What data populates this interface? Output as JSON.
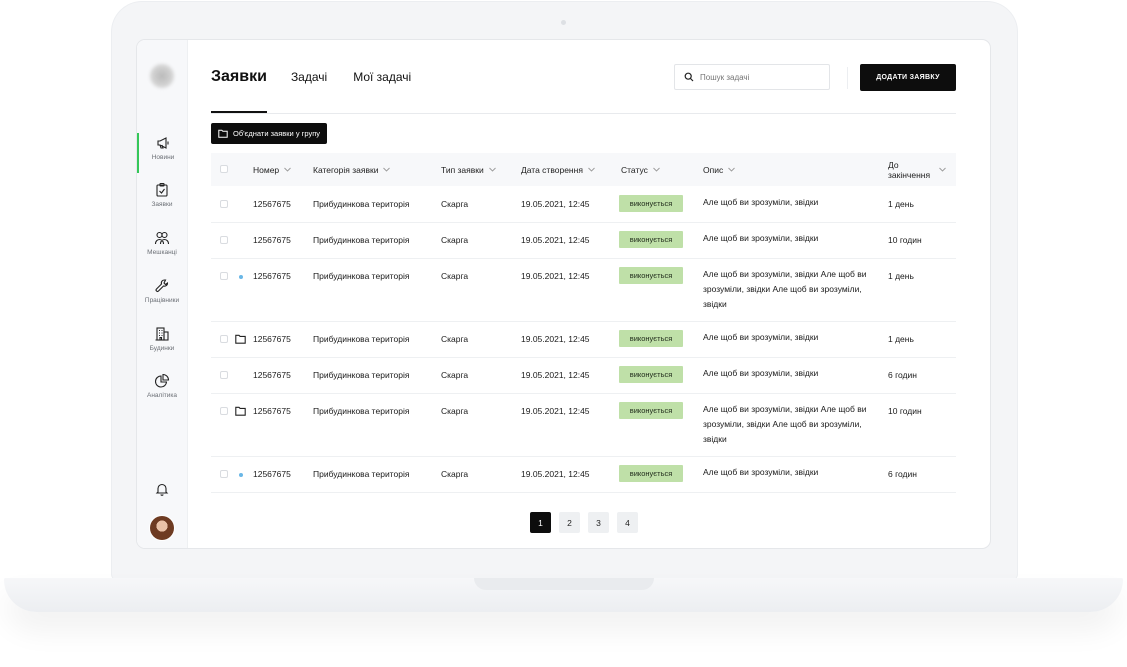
{
  "sidebar": {
    "items": [
      {
        "label": "Новини",
        "icon": "megaphone-icon",
        "active": true
      },
      {
        "label": "Заявки",
        "icon": "clipboard-check-icon",
        "active": false
      },
      {
        "label": "Мешканці",
        "icon": "users-icon",
        "active": false
      },
      {
        "label": "Працівники",
        "icon": "wrench-icon",
        "active": false
      },
      {
        "label": "Будинки",
        "icon": "building-icon",
        "active": false
      },
      {
        "label": "Аналітика",
        "icon": "pie-chart-icon",
        "active": false
      }
    ]
  },
  "header": {
    "title": "Заявки",
    "tabs": [
      "Задачі",
      "Мої задачі"
    ],
    "search_placeholder": "Пошук задачі",
    "add_button": "ДОДАТИ ЗАЯВКУ",
    "group_button": "Об'єднати заявки у групу"
  },
  "table": {
    "columns": [
      "Номер",
      "Категорія заявки",
      "Тип заявки",
      "Дата створення",
      "Статус",
      "Опис",
      "До закінчення"
    ],
    "rows": [
      {
        "marker": "none",
        "number": "12567675",
        "category": "Прибудинкова територія",
        "type": "Скарга",
        "date": "19.05.2021, 12:45",
        "status": "виконується",
        "description": "Але щоб ви зрозуміли, звідки",
        "deadline": "1 день"
      },
      {
        "marker": "none",
        "number": "12567675",
        "category": "Прибудинкова територія",
        "type": "Скарга",
        "date": "19.05.2021, 12:45",
        "status": "виконується",
        "description": "Але щоб ви зрозуміли, звідки",
        "deadline": "10 годин"
      },
      {
        "marker": "dot",
        "number": "12567675",
        "category": "Прибудинкова територія",
        "type": "Скарга",
        "date": "19.05.2021, 12:45",
        "status": "виконується",
        "description": "Але щоб ви зрозуміли, звідки Але щоб ви зрозуміли, звідки Але щоб ви зрозуміли, звідки",
        "deadline": "1 день"
      },
      {
        "marker": "folder",
        "number": "12567675",
        "category": "Прибудинкова територія",
        "type": "Скарга",
        "date": "19.05.2021, 12:45",
        "status": "виконується",
        "description": "Але щоб ви зрозуміли, звідки",
        "deadline": "1 день"
      },
      {
        "marker": "none",
        "number": "12567675",
        "category": "Прибудинкова територія",
        "type": "Скарга",
        "date": "19.05.2021, 12:45",
        "status": "виконується",
        "description": "Але щоб ви зрозуміли, звідки",
        "deadline": "6 годин"
      },
      {
        "marker": "folder",
        "number": "12567675",
        "category": "Прибудинкова територія",
        "type": "Скарга",
        "date": "19.05.2021, 12:45",
        "status": "виконується",
        "description": "Але щоб ви зрозуміли, звідки Але щоб ви зрозуміли, звідки Але щоб ви зрозуміли, звідки",
        "deadline": "10 годин"
      },
      {
        "marker": "dot",
        "number": "12567675",
        "category": "Прибудинкова територія",
        "type": "Скарга",
        "date": "19.05.2021, 12:45",
        "status": "виконується",
        "description": "Але щоб ви зрозуміли, звідки",
        "deadline": "6 годин"
      }
    ]
  },
  "pagination": {
    "pages": [
      "1",
      "2",
      "3",
      "4"
    ],
    "current": "1"
  },
  "colors": {
    "accent": "#34c759",
    "status_bg": "#bfe0a8",
    "primary_button": "#0d0d0d",
    "dot": "#6ab7e6"
  }
}
